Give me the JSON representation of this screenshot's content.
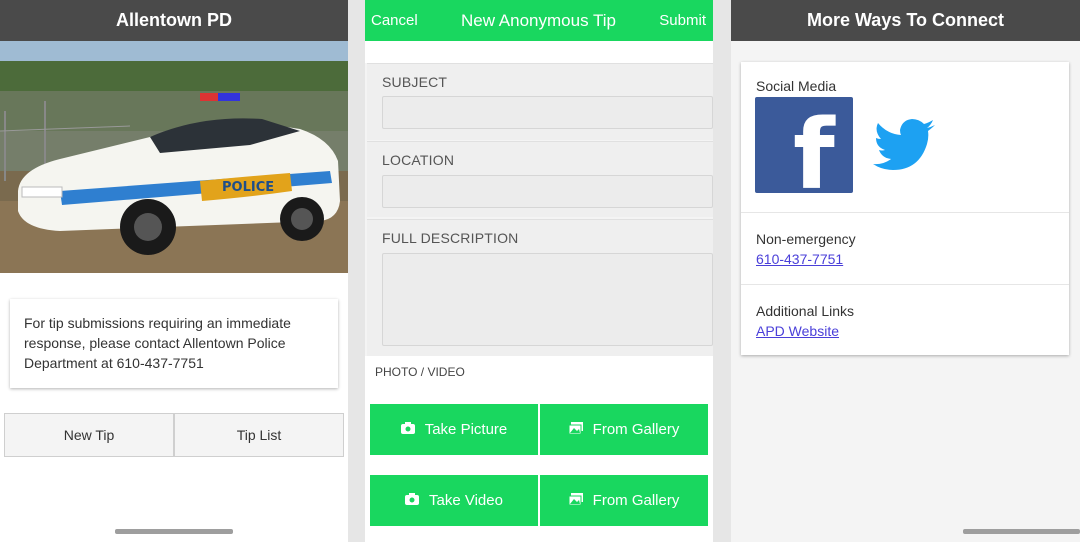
{
  "screen1": {
    "title": "Allentown PD",
    "photo": {
      "car_text": "POLICE"
    },
    "info_text": "For tip submissions requiring an immediate response, please contact Allentown Police Department at 610-437-7751",
    "buttons": {
      "new_tip": "New Tip",
      "tip_list": "Tip List"
    }
  },
  "screen2": {
    "header": {
      "cancel": "Cancel",
      "title": "New Anonymous Tip",
      "submit": "Submit"
    },
    "fields": {
      "subject": {
        "label": "SUBJECT",
        "value": ""
      },
      "location": {
        "label": "LOCATION",
        "value": ""
      },
      "description": {
        "label": "FULL DESCRIPTION",
        "value": ""
      }
    },
    "photo_video_label": "PHOTO / VIDEO",
    "buttons": {
      "take_picture": "Take Picture",
      "picture_gallery": "From Gallery",
      "take_video": "Take Video",
      "video_gallery": "From Gallery"
    },
    "icons": {
      "camera": "camera-icon",
      "gallery": "gallery-icon"
    }
  },
  "screen3": {
    "title": "More Ways To Connect",
    "social_label": "Social Media",
    "facebook_letter": "f",
    "non_emergency_label": "Non-emergency",
    "phone": "610-437-7751",
    "additional_links_label": "Additional Links",
    "website": "APD Website"
  },
  "colors": {
    "header_dark": "#4a4a4a",
    "accent_green": "#19d75f",
    "facebook_blue": "#3b5a9a",
    "twitter_blue": "#1da1f2",
    "link_purple": "#4a3fd9"
  }
}
